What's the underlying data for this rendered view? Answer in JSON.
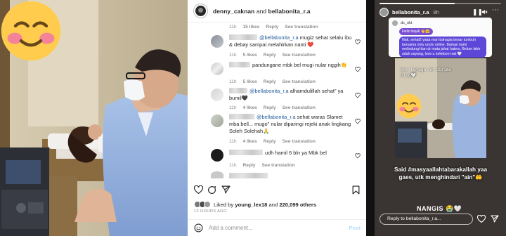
{
  "post": {
    "header_user1": "denny_caknan",
    "header_and": " and ",
    "header_user2": "bellabonita_r.a",
    "top_meta": {
      "time": "11h",
      "likes": "15 likes",
      "reply": "Reply",
      "translate": "See translation"
    },
    "comments": [
      {
        "mention": "@bellabonita_r.a",
        "text": " mugi2 sehat selalu ibu & debay sampai melahirkan nanti ❤️",
        "time": "11h",
        "likes": "5 likes",
        "reply": "Reply",
        "translate": "See translation"
      },
      {
        "mention": "",
        "text": "pandungane mbk bel mugi nular nggih👏",
        "time": "11h",
        "likes": "5 likes",
        "reply": "Reply",
        "translate": "See translation"
      },
      {
        "mention": "@bellabonita_r.a",
        "text": " alhamdulillah sehat\" ya bumil🖤",
        "time": "11h",
        "likes": "4 likes",
        "reply": "Reply",
        "translate": "See translation"
      },
      {
        "mention": "@bellabonita_r.a",
        "text": " sehat waras Slamet mba bell... mugo\" nular diparingi rejeki anak lingkang Soleh Solehah🙏",
        "time": "11h",
        "likes": "4 likes",
        "reply": "Reply",
        "translate": "See translation"
      },
      {
        "mention": "",
        "text": "udh hamil 6 bln ya Mbk bel",
        "time": "11h",
        "likes": "",
        "reply": "Reply",
        "translate": "See translation"
      }
    ],
    "liked_prefix": "Liked by ",
    "liked_user": "young_lex18",
    "liked_middle": " and ",
    "liked_others": "220,099 others",
    "posted_time": "12 HOURS AGO",
    "add_comment_placeholder": "Add a comment...",
    "post_button": "Post"
  },
  "story": {
    "username": "bellabonita_r.a",
    "time": "8h",
    "progress_fraction": 0.62,
    "dm_sender": "dc_okt",
    "dm_msg1": "Hello bayik 👋🤗",
    "dm_msg2": "Nak, sehat2 yaaa mari bahagia besar tumbuh bersama onty uncle online. Barkan kami melindungi kan dr mata jahat haters. Belum lahir udah sayang, love u sekebon nak 🤍",
    "caption_line1": "Kan kujaga oh dirimu",
    "caption_line2": "bing🤍",
    "hashtag_line1": "Said #masyaallahtabarakallah yaa",
    "hashtag_line2": "gaes, utk menghindari \"ain\"🤲",
    "nangis": "NANGIS 😭🤍",
    "reply_placeholder": "Reply to bellabonita_r.a..."
  }
}
